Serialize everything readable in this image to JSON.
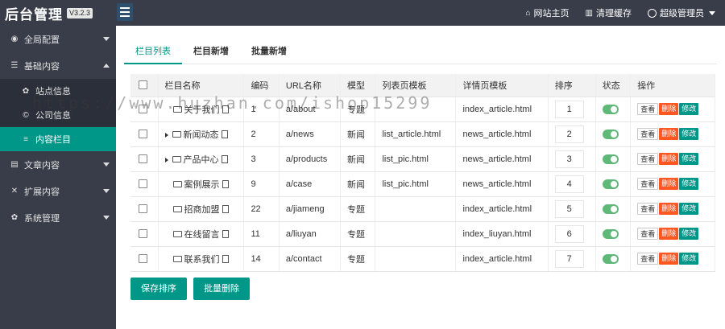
{
  "header": {
    "title": "后台管理",
    "version": "V3.2.3",
    "links": [
      {
        "icon": "home-icon",
        "label": "网站主页"
      },
      {
        "icon": "trash-icon",
        "label": "清理缓存"
      }
    ],
    "user": "超级管理员"
  },
  "sidebar": {
    "items": [
      {
        "icon": "globe-icon",
        "label": "全局配置"
      },
      {
        "icon": "sliders-icon",
        "label": "基础内容"
      },
      {
        "icon": "gear-icon",
        "label": "站点信息"
      },
      {
        "icon": "copyright-icon",
        "label": "公司信息"
      },
      {
        "icon": "list-icon",
        "label": "内容栏目"
      },
      {
        "icon": "file-icon",
        "label": "文章内容"
      },
      {
        "icon": "expand-icon",
        "label": "扩展内容"
      },
      {
        "icon": "gear-icon",
        "label": "系统管理"
      }
    ]
  },
  "tabs": [
    "栏目列表",
    "栏目新增",
    "批量新增"
  ],
  "table": {
    "headers": [
      "栏目名称",
      "编码",
      "URL名称",
      "模型",
      "列表页模板",
      "详情页模板",
      "排序",
      "状态",
      "操作"
    ],
    "rows": [
      {
        "name": "关于我们",
        "code": "1",
        "url": "a/about",
        "model": "专题",
        "list_tpl": "",
        "detail_tpl": "index_article.html",
        "sort": "1"
      },
      {
        "name": "新闻动态",
        "code": "2",
        "url": "a/news",
        "model": "新闻",
        "list_tpl": "list_article.html",
        "detail_tpl": "news_article.html",
        "sort": "2"
      },
      {
        "name": "产品中心",
        "code": "3",
        "url": "a/products",
        "model": "新闻",
        "list_tpl": "list_pic.html",
        "detail_tpl": "news_article.html",
        "sort": "3"
      },
      {
        "name": "案例展示",
        "code": "9",
        "url": "a/case",
        "model": "新闻",
        "list_tpl": "list_pic.html",
        "detail_tpl": "news_article.html",
        "sort": "4"
      },
      {
        "name": "招商加盟",
        "code": "22",
        "url": "a/jiameng",
        "model": "专题",
        "list_tpl": "",
        "detail_tpl": "index_article.html",
        "sort": "5"
      },
      {
        "name": "在线留言",
        "code": "11",
        "url": "a/liuyan",
        "model": "专题",
        "list_tpl": "",
        "detail_tpl": "index_liuyan.html",
        "sort": "6"
      },
      {
        "name": "联系我们",
        "code": "14",
        "url": "a/contact",
        "model": "专题",
        "list_tpl": "",
        "detail_tpl": "index_article.html",
        "sort": "7"
      }
    ],
    "actions": {
      "view": "查看",
      "delete": "删除",
      "edit": "修改"
    }
  },
  "buttons": {
    "save_sort": "保存排序",
    "batch_delete": "批量删除"
  },
  "watermark": "https://www.huzhan.com/ishop15299",
  "colors": {
    "primary": "#009688",
    "danger": "#ff5722",
    "sidebar": "#393d49",
    "switch_on": "#5fb878"
  }
}
